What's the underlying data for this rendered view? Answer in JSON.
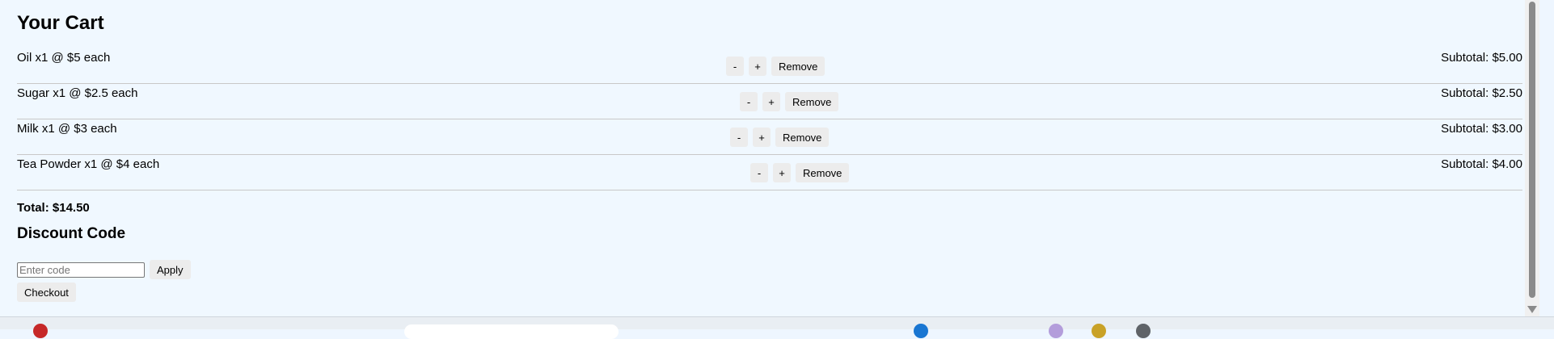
{
  "cart": {
    "title": "Your Cart",
    "items": [
      {
        "label": "Oil x1 @ $5 each",
        "subtotal": "Subtotal: $5.00"
      },
      {
        "label": "Sugar x1 @ $2.5 each",
        "subtotal": "Subtotal: $2.50"
      },
      {
        "label": "Milk x1 @ $3 each",
        "subtotal": "Subtotal: $3.00"
      },
      {
        "label": "Tea Powder x1 @ $4 each",
        "subtotal": "Subtotal: $4.00"
      }
    ],
    "decrease_label": "-",
    "increase_label": "+",
    "remove_label": "Remove",
    "total": "Total: $14.50"
  },
  "discount": {
    "title": "Discount Code",
    "placeholder": "Enter code",
    "value": "",
    "apply_label": "Apply"
  },
  "checkout": {
    "label": "Checkout"
  },
  "colors": {
    "page_background": "#f0f8ff",
    "button_background": "#ececec",
    "divider": "#c8c8c8"
  },
  "icons": [
    "scroll-down-arrow-icon",
    "taskbar-app-icon"
  ]
}
